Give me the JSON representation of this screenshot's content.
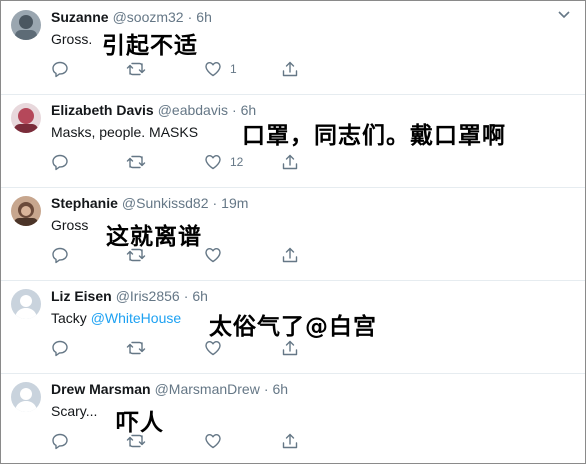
{
  "tweets": [
    {
      "name": "Suzanne",
      "handle": "@soozm32",
      "time": "6h",
      "text": "Gross.",
      "mention": "",
      "annotation": "引起不适",
      "likes": "1",
      "avatar_color": "#6b7a86"
    },
    {
      "name": "Elizabeth Davis",
      "handle": "@eabdavis",
      "time": "6h",
      "text": "Masks, people. MASKS",
      "mention": "",
      "annotation": "口罩，同志们。戴口罩啊",
      "likes": "12",
      "avatar_color": "#b5485a"
    },
    {
      "name": "Stephanie",
      "handle": "@Sunkissd82",
      "time": "19m",
      "text": "Gross",
      "mention": "",
      "annotation": "这就离谱",
      "likes": "",
      "avatar_color": "#6b4a3a"
    },
    {
      "name": "Liz Eisen",
      "handle": "@Iris2856",
      "time": "6h",
      "text": "Tacky",
      "mention": "@WhiteHouse",
      "annotation": "太俗气了@白宫",
      "likes": "",
      "avatar_color": "#c9d3dd"
    },
    {
      "name": "Drew Marsman",
      "handle": "@MarsmanDrew",
      "time": "6h",
      "text": "Scary...",
      "mention": "",
      "annotation": "吓人",
      "likes": "",
      "avatar_color": "#c9d3dd"
    }
  ],
  "separator": "·",
  "colors": {
    "accent": "#1da1f2",
    "muted": "#657786"
  }
}
